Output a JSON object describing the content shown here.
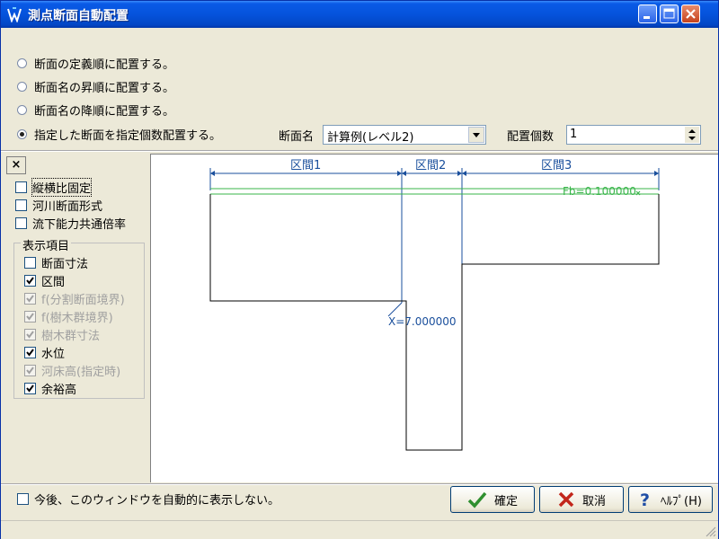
{
  "window": {
    "title": "測点断面自動配置"
  },
  "placement": {
    "options": [
      {
        "label": "断面の定義順に配置する。",
        "checked": false
      },
      {
        "label": "断面名の昇順に配置する。",
        "checked": false
      },
      {
        "label": "断面名の降順に配置する。",
        "checked": false
      },
      {
        "label": "指定した断面を指定個数配置する。",
        "checked": true
      }
    ],
    "section_name_label": "断面名",
    "section_name_value": "計算例(レベル2)",
    "count_label": "配置個数",
    "count_value": "1"
  },
  "left_panel": {
    "close_label": "×",
    "options": [
      {
        "label": "縦横比固定",
        "checked": false
      },
      {
        "label": "河川断面形式",
        "checked": false
      },
      {
        "label": "流下能力共通倍率",
        "checked": false
      }
    ],
    "display_group": {
      "title": "表示項目",
      "items": [
        {
          "label": "断面寸法",
          "checked": false,
          "enabled": true
        },
        {
          "label": "区間",
          "checked": true,
          "enabled": true
        },
        {
          "label": "f(分割断面境界)",
          "checked": true,
          "enabled": false
        },
        {
          "label": "f(樹木群境界)",
          "checked": true,
          "enabled": false
        },
        {
          "label": "樹木群寸法",
          "checked": true,
          "enabled": false
        },
        {
          "label": "水位",
          "checked": true,
          "enabled": true
        },
        {
          "label": "河床高(指定時)",
          "checked": true,
          "enabled": false
        },
        {
          "label": "余裕高",
          "checked": true,
          "enabled": true
        }
      ]
    }
  },
  "preview": {
    "sections": [
      "区間1",
      "区間2",
      "区間3"
    ],
    "fb_label": "Fb=0.100000",
    "x_label": "X=7.000000",
    "colors": {
      "section": "#1a4f9c",
      "water": "#39b54a",
      "outline": "#000000"
    }
  },
  "footer": {
    "dont_show_label": "今後、このウィンドウを自動的に表示しない。",
    "ok_label": "確定",
    "cancel_label": "取消",
    "help_label": "ﾍﾙﾌﾟ(H)"
  }
}
